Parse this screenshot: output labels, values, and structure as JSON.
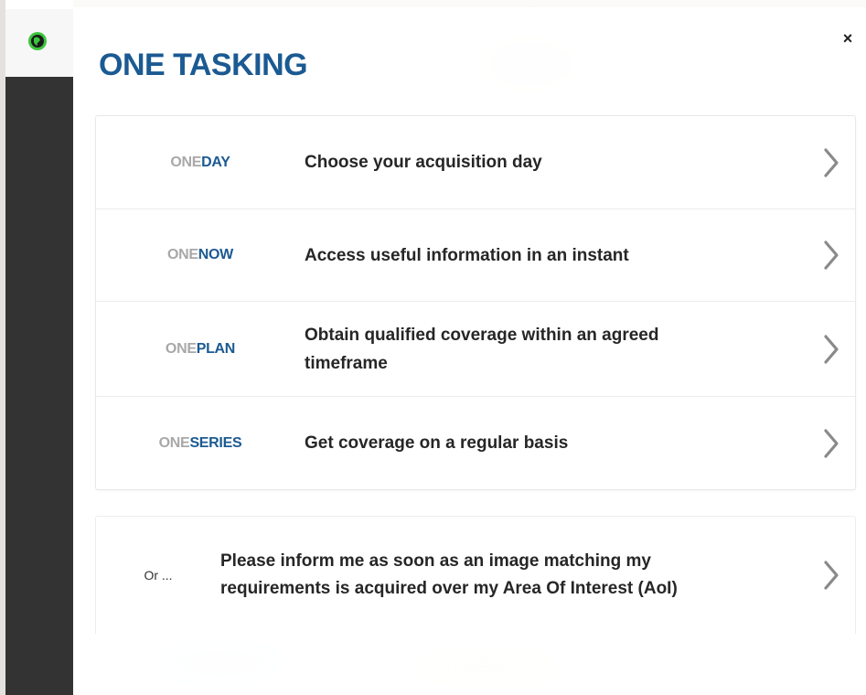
{
  "window": {
    "close_glyph": "×"
  },
  "header": {
    "title": "ONE TASKING"
  },
  "icons": {
    "logo": "globe-icon",
    "close": "close-icon",
    "chevron": "chevron-right-icon"
  },
  "colors": {
    "brand_blue": "#1b5a92",
    "brand_grey": "#a8a8a8",
    "globe_green": "#3cc63c",
    "rail_dark": "#333333"
  },
  "options": [
    {
      "brand_prefix": "ONE",
      "brand_suffix": "DAY",
      "description": "Choose your acquisition day"
    },
    {
      "brand_prefix": "ONE",
      "brand_suffix": "NOW",
      "description": "Access useful information in an instant"
    },
    {
      "brand_prefix": "ONE",
      "brand_suffix": "PLAN",
      "description": "Obtain qualified coverage within an agreed timeframe"
    },
    {
      "brand_prefix": "ONE",
      "brand_suffix": "SERIES",
      "description": "Get coverage on a regular basis"
    }
  ],
  "notify": {
    "or_label": "Or ...",
    "description": "Please inform me as soon as an image matching my requirements is acquired over my Area Of Interest (AoI)"
  }
}
